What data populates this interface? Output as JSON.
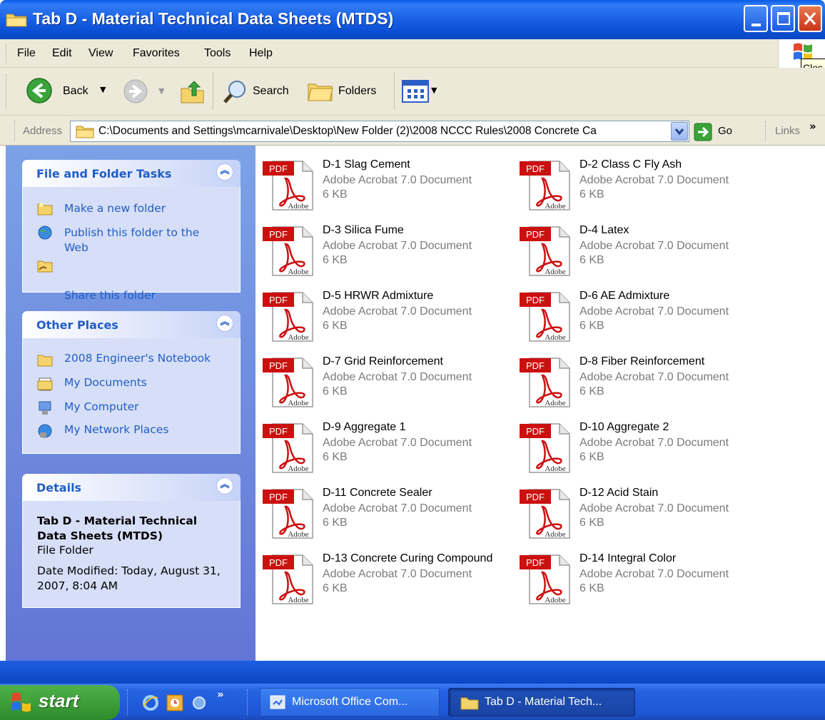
{
  "window": {
    "title": "Tab D - Material Technical Data Sheets (MTDS)"
  },
  "menu": [
    "File",
    "Edit",
    "View",
    "Favorites",
    "Tools",
    "Help"
  ],
  "tooltip": "Clos",
  "toolbar": {
    "back": "Back",
    "search": "Search",
    "folders": "Folders"
  },
  "address": {
    "label": "Address",
    "path": "C:\\Documents and Settings\\mcarnivale\\Desktop\\New Folder (2)\\2008 NCCC Rules\\2008 Concrete Ca",
    "go": "Go",
    "links": "Links"
  },
  "tasks": {
    "file_folder": {
      "title": "File and Folder Tasks",
      "items": [
        "Make a new folder",
        "Publish this folder to the Web",
        "Share this folder"
      ]
    },
    "other_places": {
      "title": "Other Places",
      "items": [
        "2008 Engineer's Notebook",
        "My Documents",
        "My Computer",
        "My Network Places"
      ]
    },
    "details": {
      "title": "Details",
      "name": "Tab D - Material Technical Data Sheets (MTDS)",
      "type": "File Folder",
      "modified": "Date Modified: Today, August 31, 2007, 8:04 AM"
    }
  },
  "files": [
    {
      "name": "D-1 Slag Cement",
      "type": "Adobe Acrobat 7.0 Document",
      "size": "6 KB"
    },
    {
      "name": "D-2 Class C Fly Ash",
      "type": "Adobe Acrobat 7.0 Document",
      "size": "6 KB"
    },
    {
      "name": "D-3 Silica Fume",
      "type": "Adobe Acrobat 7.0 Document",
      "size": "6 KB"
    },
    {
      "name": "D-4 Latex",
      "type": "Adobe Acrobat 7.0 Document",
      "size": "6 KB"
    },
    {
      "name": "D-5 HRWR Admixture",
      "type": "Adobe Acrobat 7.0 Document",
      "size": "6 KB"
    },
    {
      "name": "D-6 AE Admixture",
      "type": "Adobe Acrobat 7.0 Document",
      "size": "6 KB"
    },
    {
      "name": "D-7 Grid Reinforcement",
      "type": "Adobe Acrobat 7.0 Document",
      "size": "6 KB"
    },
    {
      "name": "D-8 Fiber Reinforcement",
      "type": "Adobe Acrobat 7.0 Document",
      "size": "6 KB"
    },
    {
      "name": "D-9 Aggregate 1",
      "type": "Adobe Acrobat 7.0 Document",
      "size": "6 KB"
    },
    {
      "name": "D-10 Aggregate 2",
      "type": "Adobe Acrobat 7.0 Document",
      "size": "6 KB"
    },
    {
      "name": "D-11 Concrete Sealer",
      "type": "Adobe Acrobat 7.0 Document",
      "size": "6 KB"
    },
    {
      "name": "D-12 Acid Stain",
      "type": "Adobe Acrobat 7.0 Document",
      "size": "6 KB"
    },
    {
      "name": "D-13 Concrete Curing Compound",
      "type": "Adobe Acrobat 7.0 Document",
      "size": "6 KB"
    },
    {
      "name": "D-14  Integral Color",
      "type": "Adobe Acrobat 7.0 Document",
      "size": "6 KB"
    }
  ],
  "pdf_icon": {
    "badge": "PDF",
    "brand": "Adobe"
  },
  "taskbar": {
    "start": "start",
    "buttons": [
      "Microsoft Office Com...",
      "Tab D - Material Tech..."
    ]
  },
  "colors": {
    "title_blue": "#0a4fd4",
    "task_link": "#215dc6",
    "pdf_red": "#cc1010",
    "start_green": "#3a9c35"
  },
  "icons": [
    "folder-icon",
    "back-arrow-icon",
    "forward-arrow-icon",
    "up-folder-icon",
    "search-icon",
    "folders-icon",
    "views-icon",
    "go-arrow-icon",
    "pdf-file-icon",
    "windows-logo-icon",
    "collapse-chevron-icon"
  ]
}
